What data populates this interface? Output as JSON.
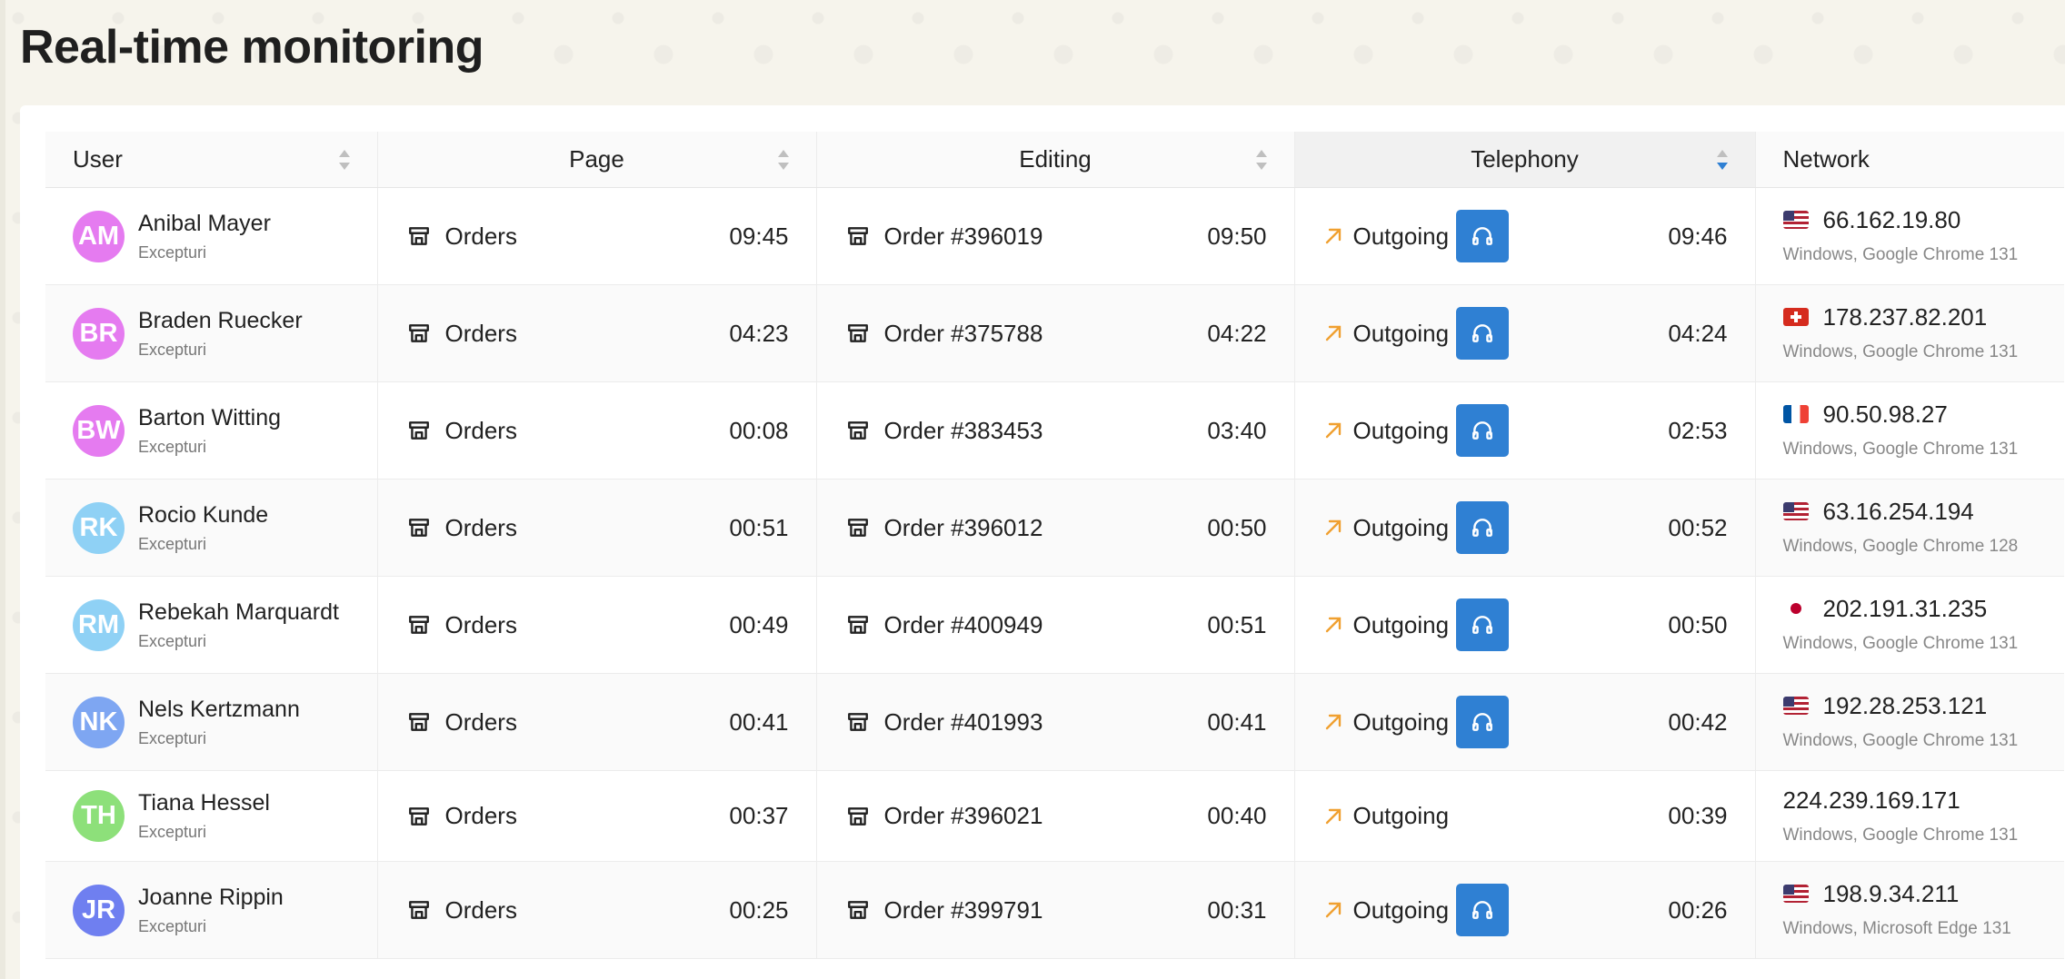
{
  "page": {
    "title": "Real-time monitoring"
  },
  "columns": {
    "user": "User",
    "page": "Page",
    "editing": "Editing",
    "telephony": "Telephony",
    "network": "Network"
  },
  "colors": {
    "accent": "#2f80d3",
    "outgoing_arrow": "#f0a030"
  },
  "rows": [
    {
      "initials": "AM",
      "avatar_color": "#e57bf0",
      "name": "Anibal Mayer",
      "role": "Excepturi",
      "page": "Orders",
      "page_time": "09:45",
      "editing": "Order #396019",
      "editing_time": "09:50",
      "call": "Outgoing",
      "headset": true,
      "call_time": "09:46",
      "flag": "us",
      "ip": "66.162.19.80",
      "os": "Windows, Google Chrome 131"
    },
    {
      "initials": "BR",
      "avatar_color": "#e57bf0",
      "name": "Braden Ruecker",
      "role": "Excepturi",
      "page": "Orders",
      "page_time": "04:23",
      "editing": "Order #375788",
      "editing_time": "04:22",
      "call": "Outgoing",
      "headset": true,
      "call_time": "04:24",
      "flag": "ch",
      "ip": "178.237.82.201",
      "os": "Windows, Google Chrome 131"
    },
    {
      "initials": "BW",
      "avatar_color": "#e57bf0",
      "name": "Barton Witting",
      "role": "Excepturi",
      "page": "Orders",
      "page_time": "00:08",
      "editing": "Order #383453",
      "editing_time": "03:40",
      "call": "Outgoing",
      "headset": true,
      "call_time": "02:53",
      "flag": "fr",
      "ip": "90.50.98.27",
      "os": "Windows, Google Chrome 131"
    },
    {
      "initials": "RK",
      "avatar_color": "#8fd1f5",
      "name": "Rocio Kunde",
      "role": "Excepturi",
      "page": "Orders",
      "page_time": "00:51",
      "editing": "Order #396012",
      "editing_time": "00:50",
      "call": "Outgoing",
      "headset": true,
      "call_time": "00:52",
      "flag": "us",
      "ip": "63.16.254.194",
      "os": "Windows, Google Chrome 128"
    },
    {
      "initials": "RM",
      "avatar_color": "#8fd1f5",
      "name": "Rebekah Marquardt",
      "role": "Excepturi",
      "page": "Orders",
      "page_time": "00:49",
      "editing": "Order #400949",
      "editing_time": "00:51",
      "call": "Outgoing",
      "headset": true,
      "call_time": "00:50",
      "flag": "jp",
      "ip": "202.191.31.235",
      "os": "Windows, Google Chrome 131"
    },
    {
      "initials": "NK",
      "avatar_color": "#7ea6f2",
      "name": "Nels Kertzmann",
      "role": "Excepturi",
      "page": "Orders",
      "page_time": "00:41",
      "editing": "Order #401993",
      "editing_time": "00:41",
      "call": "Outgoing",
      "headset": true,
      "call_time": "00:42",
      "flag": "us",
      "ip": "192.28.253.121",
      "os": "Windows, Google Chrome 131"
    },
    {
      "initials": "TH",
      "avatar_color": "#8de07a",
      "name": "Tiana Hessel",
      "role": "Excepturi",
      "page": "Orders",
      "page_time": "00:37",
      "editing": "Order #396021",
      "editing_time": "00:40",
      "call": "Outgoing",
      "headset": false,
      "call_time": "00:39",
      "flag": "",
      "ip": "224.239.169.171",
      "os": "Windows, Google Chrome 131"
    },
    {
      "initials": "JR",
      "avatar_color": "#6f7ff0",
      "name": "Joanne Rippin",
      "role": "Excepturi",
      "page": "Orders",
      "page_time": "00:25",
      "editing": "Order #399791",
      "editing_time": "00:31",
      "call": "Outgoing",
      "headset": true,
      "call_time": "00:26",
      "flag": "us",
      "ip": "198.9.34.211",
      "os": "Windows, Microsoft Edge 131"
    }
  ]
}
